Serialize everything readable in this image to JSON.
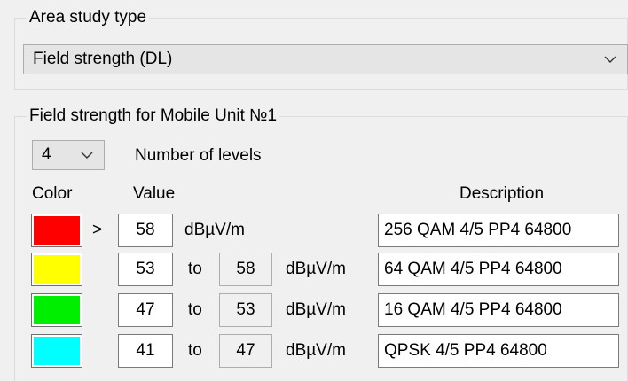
{
  "area_study": {
    "legend": "Area study type",
    "selected": "Field strength (DL)"
  },
  "field_strength": {
    "legend": "Field strength for Mobile Unit №1",
    "levels_value": "4",
    "levels_label": "Number of levels",
    "col_color": "Color",
    "col_value": "Value",
    "col_description": "Description",
    "rows": [
      {
        "color": "#ff0000",
        "op": ">",
        "from": "58",
        "to_word": "",
        "to": "",
        "unit": "dBµV/m",
        "description": "256 QAM 4/5 PP4 64800"
      },
      {
        "color": "#ffff00",
        "op": "",
        "from": "53",
        "to_word": "to",
        "to": "58",
        "unit": "dBµV/m",
        "description": "64 QAM 4/5 PP4 64800"
      },
      {
        "color": "#00ee00",
        "op": "",
        "from": "47",
        "to_word": "to",
        "to": "53",
        "unit": "dBµV/m",
        "description": "16 QAM 4/5 PP4 64800"
      },
      {
        "color": "#00ffff",
        "op": "",
        "from": "41",
        "to_word": "to",
        "to": "47",
        "unit": "dBµV/m",
        "description": "QPSK 4/5 PP4 64800"
      }
    ]
  },
  "icons": {
    "dropdown": "chevron-down-icon"
  }
}
